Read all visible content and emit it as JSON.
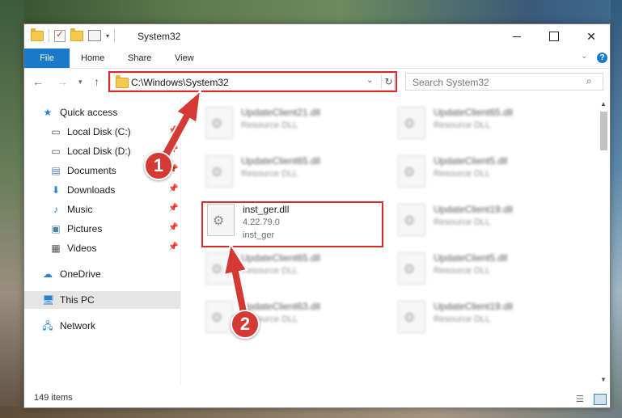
{
  "window": {
    "title": "System32"
  },
  "ribbon": {
    "tabs": [
      {
        "label": "File"
      },
      {
        "label": "Home"
      },
      {
        "label": "Share"
      },
      {
        "label": "View"
      }
    ],
    "help": "?"
  },
  "navbar": {
    "address": "C:\\Windows\\System32",
    "search_placeholder": "Search System32"
  },
  "sidebar": {
    "items": [
      {
        "label": "Quick access",
        "icon": "star-icon"
      },
      {
        "label": "Local Disk (C:)",
        "icon": "drive-icon"
      },
      {
        "label": "Local Disk (D:)",
        "icon": "drive-icon"
      },
      {
        "label": "Documents",
        "icon": "documents-icon"
      },
      {
        "label": "Downloads",
        "icon": "download-icon"
      },
      {
        "label": "Music",
        "icon": "music-icon"
      },
      {
        "label": "Pictures",
        "icon": "pictures-icon"
      },
      {
        "label": "Videos",
        "icon": "videos-icon"
      },
      {
        "label": "OneDrive",
        "icon": "cloud-icon"
      },
      {
        "label": "This PC",
        "icon": "computer-icon"
      },
      {
        "label": "Network",
        "icon": "network-icon"
      }
    ]
  },
  "files": [
    {
      "name": "UpdateClient21.dll",
      "line2": "Resource DLL",
      "line3": ""
    },
    {
      "name": "UpdateClient65.dll",
      "line2": "Resource DLL",
      "line3": ""
    },
    {
      "name": "UpdateClient65.dll",
      "line2": "Resource DLL",
      "line3": ""
    },
    {
      "name": "UpdateClient5.dll",
      "line2": "Resource DLL",
      "line3": ""
    },
    {
      "name": "inst_ger.dll",
      "line2": "4.22.79.0",
      "line3": "inst_ger"
    },
    {
      "name": "UpdateClient19.dll",
      "line2": "Resource DLL",
      "line3": ""
    },
    {
      "name": "UpdateClient65.dll",
      "line2": "Resource DLL",
      "line3": ""
    },
    {
      "name": "UpdateClient5.dll",
      "line2": "Resource DLL",
      "line3": ""
    },
    {
      "name": "UpdateClient63.dll",
      "line2": "Resource DLL",
      "line3": ""
    },
    {
      "name": "UpdateClient19.dll",
      "line2": "Resource DLL",
      "line3": ""
    }
  ],
  "status": {
    "count": "149 items"
  },
  "callouts": {
    "one": "1",
    "two": "2"
  },
  "colors": {
    "accent": "#1979ca",
    "highlight": "#d62b2b",
    "callout": "#d43a33"
  }
}
